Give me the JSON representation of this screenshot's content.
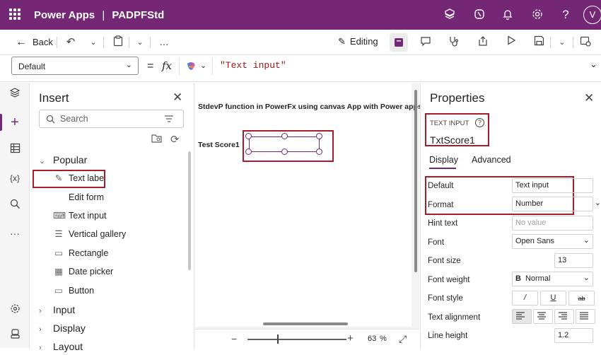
{
  "titlebar": {
    "app_name": "Power Apps",
    "separator": "|",
    "doc_name": "PADPFStd",
    "avatar_initial": "V",
    "icons": [
      "waffle-icon",
      "environment-icon",
      "copilot-icon",
      "bell-icon",
      "gear-icon",
      "help-icon"
    ]
  },
  "cmdbar": {
    "back_label": "Back",
    "editing_label": "Editing",
    "more": "..."
  },
  "formula": {
    "property": "Default",
    "equals": "=",
    "fx": "fx",
    "value": "\"Text input\""
  },
  "insert": {
    "title": "Insert",
    "search_placeholder": "Search",
    "popular_label": "Popular",
    "items": [
      "Text label",
      "Edit form",
      "Text input",
      "Vertical gallery",
      "Rectangle",
      "Date picker",
      "Button"
    ],
    "groups": [
      "Input",
      "Display",
      "Layout"
    ]
  },
  "canvas": {
    "heading": "StdevP function in PowerFx using canvas App with Power apps",
    "label": "Test Score1",
    "zoom_minus": "−",
    "zoom_plus": "+",
    "zoom_value": "63",
    "zoom_unit": "%"
  },
  "properties": {
    "title": "Properties",
    "control_type": "TEXT INPUT",
    "control_name": "TxtScore1",
    "tabs": [
      "Display",
      "Advanced"
    ],
    "rows": [
      {
        "label": "Default",
        "value": "Text input"
      },
      {
        "label": "Format",
        "value": "Number"
      },
      {
        "label": "Hint text",
        "value": "No value"
      },
      {
        "label": "Font",
        "value": "Open Sans"
      },
      {
        "label": "Font size",
        "value": "13"
      },
      {
        "label": "Font weight",
        "value": "Normal",
        "prefix": "B"
      },
      {
        "label": "Font style",
        "value": ""
      },
      {
        "label": "Text alignment",
        "value": ""
      },
      {
        "label": "Line height",
        "value": "1.2"
      }
    ],
    "fontstyle_buttons": [
      "/",
      "U",
      "ab"
    ]
  },
  "colors": {
    "brand": "#742774",
    "highlight": "#a51d2d"
  }
}
